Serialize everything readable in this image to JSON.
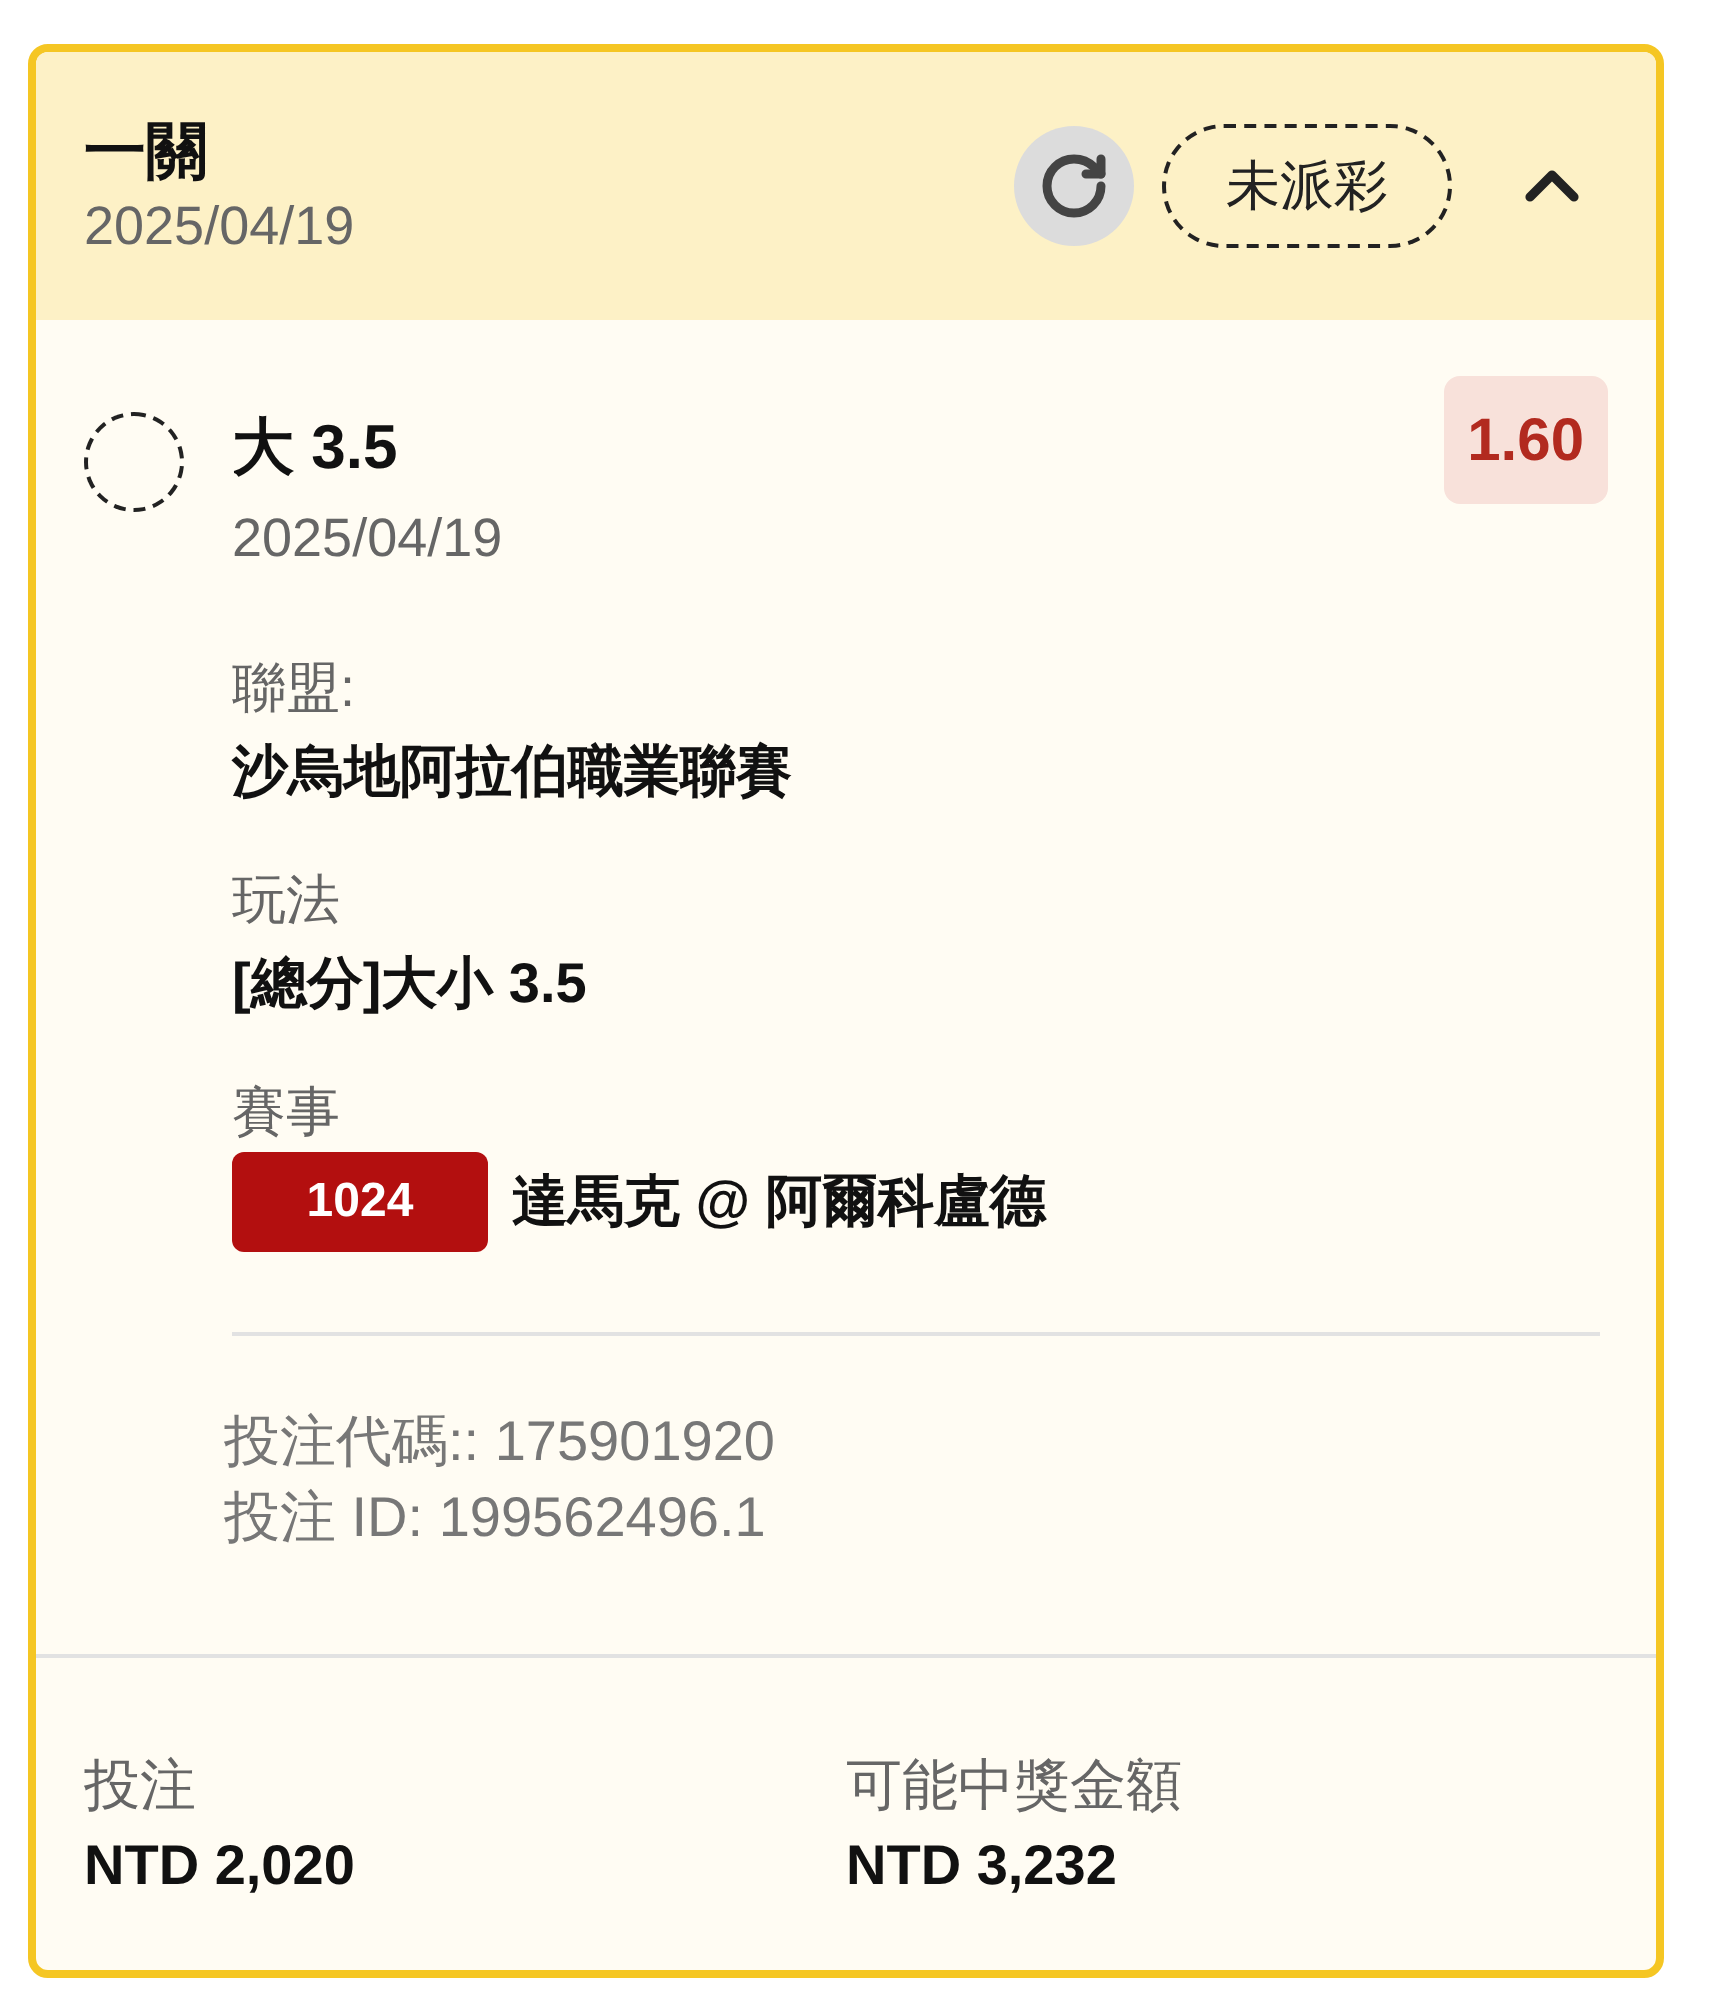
{
  "header": {
    "title": "一關",
    "date": "2025/04/19",
    "status": "未派彩",
    "expanded": true
  },
  "selection": {
    "name": "大 3.5",
    "date": "2025/04/19",
    "odds": "1.60",
    "details": [
      {
        "label": "聯盟:",
        "value": "沙烏地阿拉伯職業聯賽"
      },
      {
        "label": "玩法",
        "value": "[總分]大小 3.5"
      },
      {
        "label": "賽事",
        "badge": "1024",
        "value": "達馬克 @ 阿爾科盧德"
      }
    ],
    "bet_code": "投注代碼:: 175901920",
    "bet_id": "投注 ID: 199562496.1"
  },
  "footer": [
    {
      "label": "投注",
      "value": "NTD 2,020"
    },
    {
      "label": "可能中獎金額",
      "value": "NTD 3,232"
    }
  ]
}
